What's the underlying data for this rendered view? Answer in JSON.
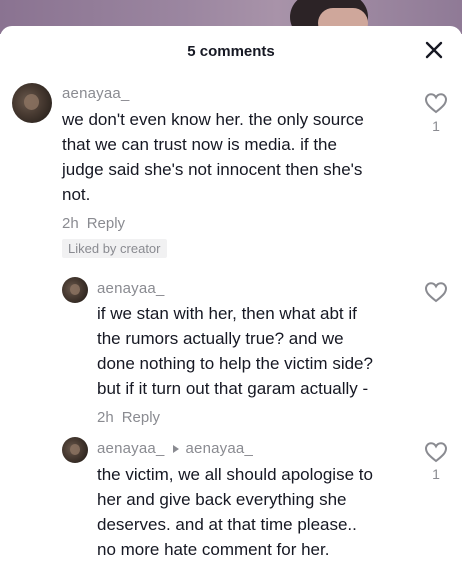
{
  "header": {
    "title": "5 comments",
    "close_icon": "close-icon"
  },
  "comments": [
    {
      "username": "aenayaa_",
      "text_lines": [
        "we don't even know her. the only source",
        "that we can trust now is media. if the",
        "judge said she's not innocent then she's",
        "not."
      ],
      "time": "2h",
      "reply_label": "Reply",
      "liked_badge": "Liked by creator",
      "like_count": "1"
    }
  ],
  "replies": [
    {
      "username": "aenayaa_",
      "text_lines": [
        "if we stan with her, then what abt if",
        "the rumors actually true? and we",
        "done nothing to help the victim side?",
        "but if it turn out that garam actually -"
      ],
      "time": "2h",
      "reply_label": "Reply"
    },
    {
      "username": "aenayaa_",
      "reply_to": "aenayaa_",
      "text_lines": [
        "the victim, we all should apologise to",
        "her and give back everything she",
        "deserves. and at that time please..",
        "no more hate comment for her."
      ],
      "like_count": "1"
    }
  ],
  "colors": {
    "text": "#161823",
    "secondary": "#8a8b91"
  }
}
